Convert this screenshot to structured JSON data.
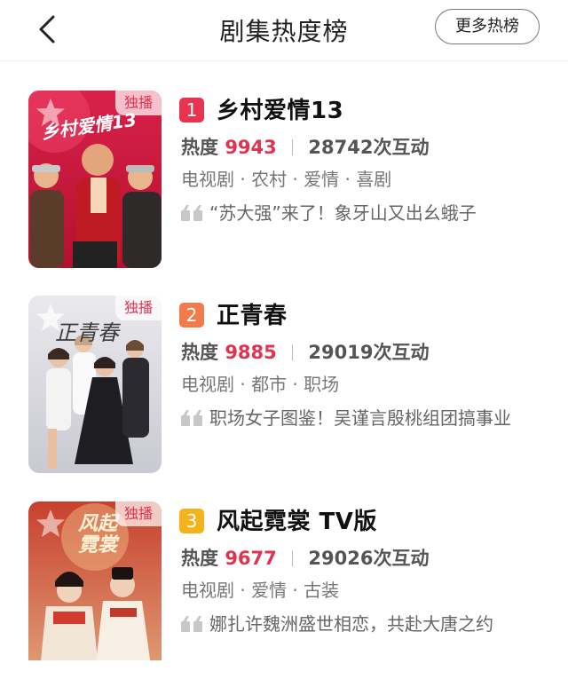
{
  "header": {
    "title": "剧集热度榜",
    "more_label": "更多热榜"
  },
  "items": [
    {
      "rank": "1",
      "rank_color": "#e8344f",
      "title": "乡村爱情13",
      "heat_label": "热度",
      "heat_value": "9943",
      "interactions": "28742次互动",
      "tags": "电视剧 · 农村 · 爱情 · 喜剧",
      "quote": "“苏大强”来了！象牙山又出幺蛾子",
      "badge": "独播",
      "poster_text": "乡村爱情13"
    },
    {
      "rank": "2",
      "rank_color": "#f37b4a",
      "title": "正青春",
      "heat_label": "热度",
      "heat_value": "9885",
      "interactions": "29019次互动",
      "tags": "电视剧 · 都市 · 职场",
      "quote": "职场女子图鉴！吴谨言殷桃组团搞事业",
      "badge": "独播",
      "poster_text": "正青春"
    },
    {
      "rank": "3",
      "rank_color": "#f5b21b",
      "title": "风起霓裳 TV版",
      "heat_label": "热度",
      "heat_value": "9677",
      "interactions": "29026次互动",
      "tags": "电视剧 · 爱情 · 古装",
      "quote": "娜扎许魏洲盛世相恋，共赴大唐之约",
      "badge": "独播",
      "poster_text": "风起霓裳"
    }
  ]
}
